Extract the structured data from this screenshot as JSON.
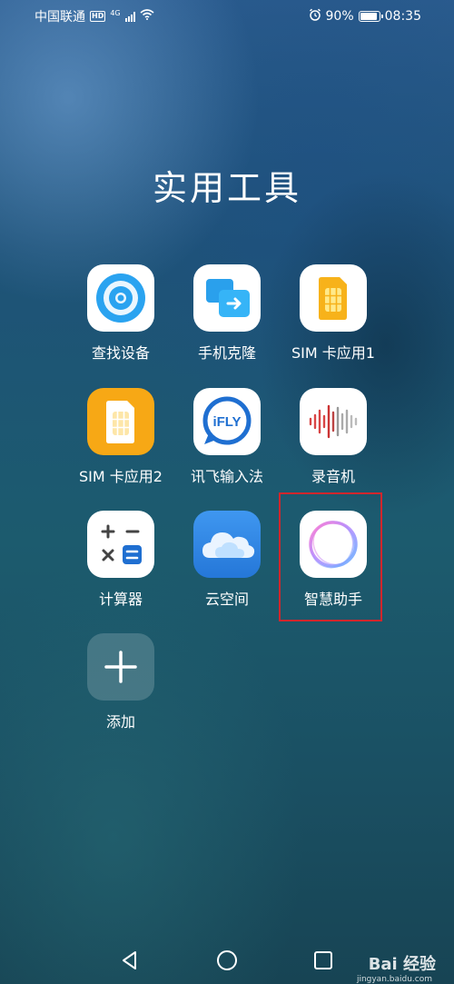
{
  "status_bar": {
    "carrier": "中国联通",
    "hd": "HD",
    "network": "4G",
    "battery_percent": "90%",
    "battery_level": 0.9,
    "time": "08:35"
  },
  "folder": {
    "title": "实用工具",
    "apps": [
      {
        "label": "查找设备",
        "icon": "find-device-icon"
      },
      {
        "label": "手机克隆",
        "icon": "phone-clone-icon"
      },
      {
        "label": "SIM 卡应用1",
        "icon": "sim-card-icon"
      },
      {
        "label": "SIM 卡应用2",
        "icon": "sim-card-icon"
      },
      {
        "label": "讯飞输入法",
        "icon": "ifly-icon",
        "icon_text": "iFLY"
      },
      {
        "label": "录音机",
        "icon": "recorder-icon"
      },
      {
        "label": "计算器",
        "icon": "calculator-icon"
      },
      {
        "label": "云空间",
        "icon": "cloud-icon"
      },
      {
        "label": "智慧助手",
        "icon": "assistant-icon"
      },
      {
        "label": "添加",
        "icon": "add-icon"
      }
    ]
  },
  "navigation": {
    "back": "back-icon",
    "home": "home-icon",
    "recents": "recents-icon"
  },
  "watermark": {
    "text": "Bai 经验",
    "url": "jingyan.baidu.com"
  },
  "colors": {
    "highlight": "#d1262c",
    "sim_orange": "#f7a815",
    "ifly_blue": "#1f6fd1",
    "cloud_blue": "#2f86e8"
  }
}
